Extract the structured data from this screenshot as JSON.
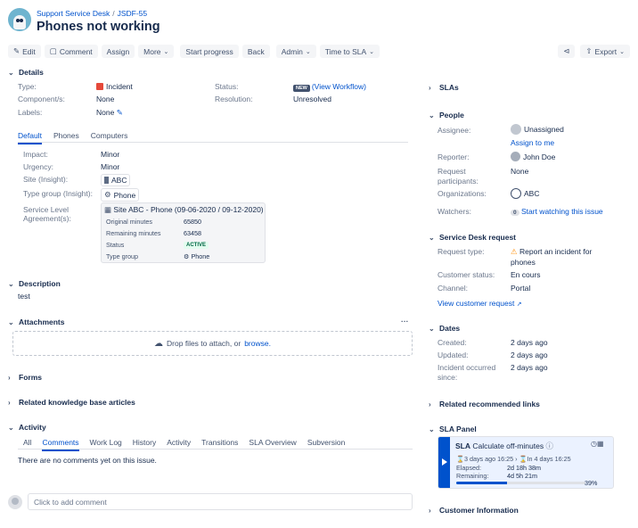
{
  "breadcrumb": {
    "project": "Support Service Desk",
    "separator": "/",
    "issue_key": "JSDF-55"
  },
  "issue": {
    "title": "Phones not working"
  },
  "toolbar": {
    "edit": "Edit",
    "comment": "Comment",
    "assign": "Assign",
    "more": "More",
    "start_progress": "Start progress",
    "back": "Back",
    "admin": "Admin",
    "time_to_sla": "Time to SLA",
    "export": "Export"
  },
  "details": {
    "heading": "Details",
    "type_label": "Type:",
    "type_value": "Incident",
    "status_label": "Status:",
    "status_badge": "NEW",
    "status_link": "(View Workflow)",
    "components_label": "Component/s:",
    "components_value": "None",
    "resolution_label": "Resolution:",
    "resolution_value": "Unresolved",
    "labels_label": "Labels:",
    "labels_value": "None"
  },
  "detail_tabs": [
    "Default",
    "Phones",
    "Computers"
  ],
  "fields": {
    "impact_label": "Impact:",
    "impact_value": "Minor",
    "urgency_label": "Urgency:",
    "urgency_value": "Minor",
    "site_label": "Site (Insight):",
    "site_value": "ABC",
    "type_group_label": "Type group (Insight):",
    "type_group_value": "Phone",
    "sla_label_1": "Service Level",
    "sla_label_2": "Agreement(s):"
  },
  "sla_card": {
    "title": "Site ABC - Phone (09-06-2020 / 09-12-2020)",
    "original_label": "Original minutes",
    "original_value": "65850",
    "remaining_label": "Remaining minutes",
    "remaining_value": "63458",
    "status_label": "Status",
    "status_value": "ACTIVE",
    "type_group_label": "Type group",
    "type_group_value": "Phone"
  },
  "description": {
    "heading": "Description",
    "text": "test"
  },
  "attachments": {
    "heading": "Attachments",
    "more": "···",
    "drop_text": "Drop files to attach, or",
    "browse": "browse."
  },
  "forms": {
    "heading": "Forms"
  },
  "kb": {
    "heading": "Related knowledge base articles"
  },
  "activity": {
    "heading": "Activity",
    "tabs": [
      "All",
      "Comments",
      "Work Log",
      "History",
      "Activity",
      "Transitions",
      "SLA Overview",
      "Subversion"
    ],
    "empty": "There are no comments yet on this issue.",
    "placeholder": "Click to add comment"
  },
  "slas": {
    "heading": "SLAs"
  },
  "people": {
    "heading": "People",
    "assignee_label": "Assignee:",
    "assignee_value": "Unassigned",
    "assign_to_me": "Assign to me",
    "reporter_label": "Reporter:",
    "reporter_value": "John Doe",
    "participants_label_1": "Request",
    "participants_label_2": "participants:",
    "participants_value": "None",
    "organizations_label": "Organizations:",
    "organizations_value": "ABC",
    "watchers_label": "Watchers:",
    "watchers_count": "0",
    "watchers_link": "Start watching this issue"
  },
  "service_desk": {
    "heading": "Service Desk request",
    "request_type_label": "Request type:",
    "request_type_1": "Report an incident for",
    "request_type_2": "phones",
    "customer_status_label": "Customer status:",
    "customer_status_value": "En cours",
    "channel_label": "Channel:",
    "channel_value": "Portal",
    "view_link": "View customer request"
  },
  "dates": {
    "heading": "Dates",
    "created_label": "Created:",
    "created_value": "2 days ago",
    "updated_label": "Updated:",
    "updated_value": "2 days ago",
    "occurred_label_1": "Incident occurred",
    "occurred_label_2": "since:",
    "occurred_value": "2 days ago"
  },
  "recommended": {
    "heading": "Related recommended links"
  },
  "sla_panel": {
    "heading": "SLA Panel",
    "sla": "SLA",
    "name": "Calculate off-minutes",
    "start": "3 days ago 16:25",
    "end": "In 4 days 16:25",
    "elapsed_label": "Elapsed:",
    "elapsed_value": "2d 18h 38m",
    "remaining_label": "Remaining:",
    "remaining_value": "4d 5h 21m",
    "percent_text": "39%",
    "progress": 0.39
  },
  "customer_info": {
    "heading": "Customer Information"
  },
  "colors": {
    "brand": "#0052cc",
    "incident": "#e5493a",
    "active": "#006644"
  }
}
